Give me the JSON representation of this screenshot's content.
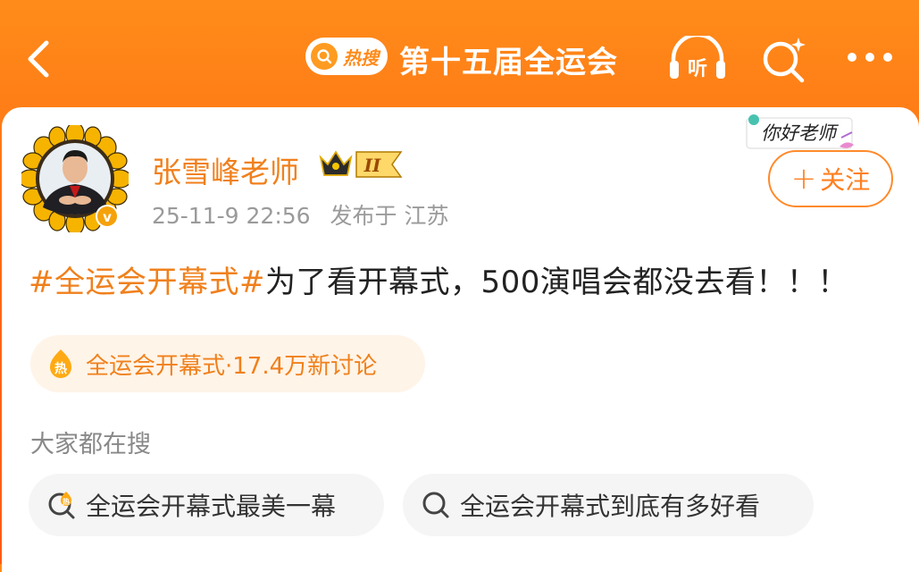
{
  "header": {
    "hot_search_pill": "热搜",
    "title": "第十五届全运会",
    "listen_label": "听",
    "icons": [
      "back-icon",
      "listen-icon",
      "search-spark-icon",
      "more-icon"
    ]
  },
  "post": {
    "author_name": "张雪峰老师",
    "vip_level": "II",
    "timestamp": "25-11-9 22:56",
    "published_location": "发布于 江苏",
    "sticker_text": "你好老师",
    "follow_label": "关注",
    "hashtag": "#全运会开幕式#",
    "body": "为了看开幕式，500演唱会都没去看！！！",
    "topic_chip": {
      "icon_text": "热",
      "label": "全运会开幕式·17.4万新讨论"
    }
  },
  "everyone_search": {
    "label": "大家都在搜",
    "items": [
      {
        "label": "全运会开幕式最美一幕",
        "icon": "hot-search-icon",
        "icon_text": "热"
      },
      {
        "label": "全运会开幕式到底有多好看",
        "icon": "search-icon"
      }
    ]
  },
  "colors": {
    "header_gradient_start": "#ff8c1a",
    "header_gradient_end": "#ff5a14",
    "accent_orange": "#f0801c",
    "chip_bg": "#fff4e8"
  }
}
